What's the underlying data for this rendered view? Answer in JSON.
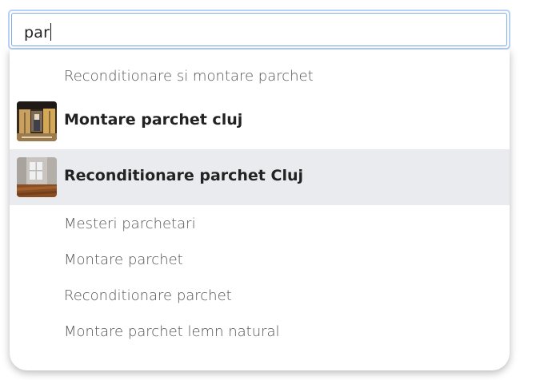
{
  "search": {
    "value": "par"
  },
  "suggestions": [
    {
      "label": "Reconditionare si montare parchet",
      "type": "text"
    },
    {
      "label": "Montare parchet cluj",
      "type": "rich",
      "thumbnail": "workshop-photo-icon"
    },
    {
      "label": "Reconditionare parchet Cluj",
      "type": "rich",
      "thumbnail": "room-floor-photo-icon",
      "highlighted": true
    },
    {
      "label": "Mesteri parchetari",
      "type": "text"
    },
    {
      "label": "Montare parchet",
      "type": "text"
    },
    {
      "label": "Reconditionare parchet",
      "type": "text"
    },
    {
      "label": "Montare parchet lemn natural",
      "type": "text"
    }
  ],
  "colors": {
    "focus_border": "#b5d1f5",
    "highlight_bg": "#e9ebee"
  }
}
